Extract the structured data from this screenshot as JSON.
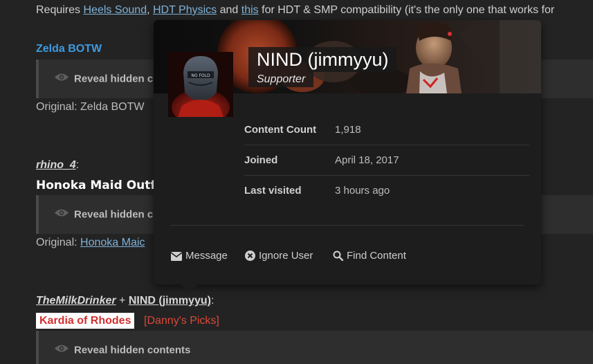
{
  "post": {
    "requires": {
      "prefix": "Requires ",
      "link1": "Heels Sound",
      "sep1": ", ",
      "link2": "HDT Physics",
      "sep2": " and ",
      "link3": "this",
      "suffix": " for HDT & SMP compatibility (it's the only one that works for"
    },
    "section1_title": "Zelda BOTW",
    "spoiler_label": "Reveal hidden contents",
    "spoiler_label_cut": "Reveal hidden c",
    "original1": "Original: Zelda BOTW",
    "author1": "rhino_4",
    "author1_suffix": ":",
    "comic_title": "Honoka Maid Outfit",
    "original2_prefix": "Original: ",
    "original2_link": "Honoka Maic",
    "author2": "TheMilkDrinker",
    "author2_join": " + ",
    "author2b": "NIND (jimmyyu)",
    "author2_suffix": ":",
    "kardia": "Kardia of Rhodes",
    "dannys": "[Danny's Picks]"
  },
  "hovercard": {
    "name": "NIND (jimmyyu)",
    "group": "Supporter",
    "stats": [
      {
        "label": "Content Count",
        "value": "1,918"
      },
      {
        "label": "Joined",
        "value": "April 18, 2017"
      },
      {
        "label": "Last visited",
        "value": "3 hours ago"
      }
    ],
    "actions": {
      "message": "Message",
      "ignore": "Ignore User",
      "find": "Find Content"
    },
    "avatar_badge": "NO FOLD"
  },
  "colors": {
    "background": "#232323",
    "link": "#7fb2d9",
    "section_title": "#3d9be0",
    "card_bg": "#1d1d1d",
    "kardia_text": "#d32f2f",
    "dannys_text": "#d84a3a"
  },
  "icons": {
    "eye": "eye-icon",
    "message": "envelope-icon",
    "ignore": "x-circle-icon",
    "find": "search-icon"
  }
}
